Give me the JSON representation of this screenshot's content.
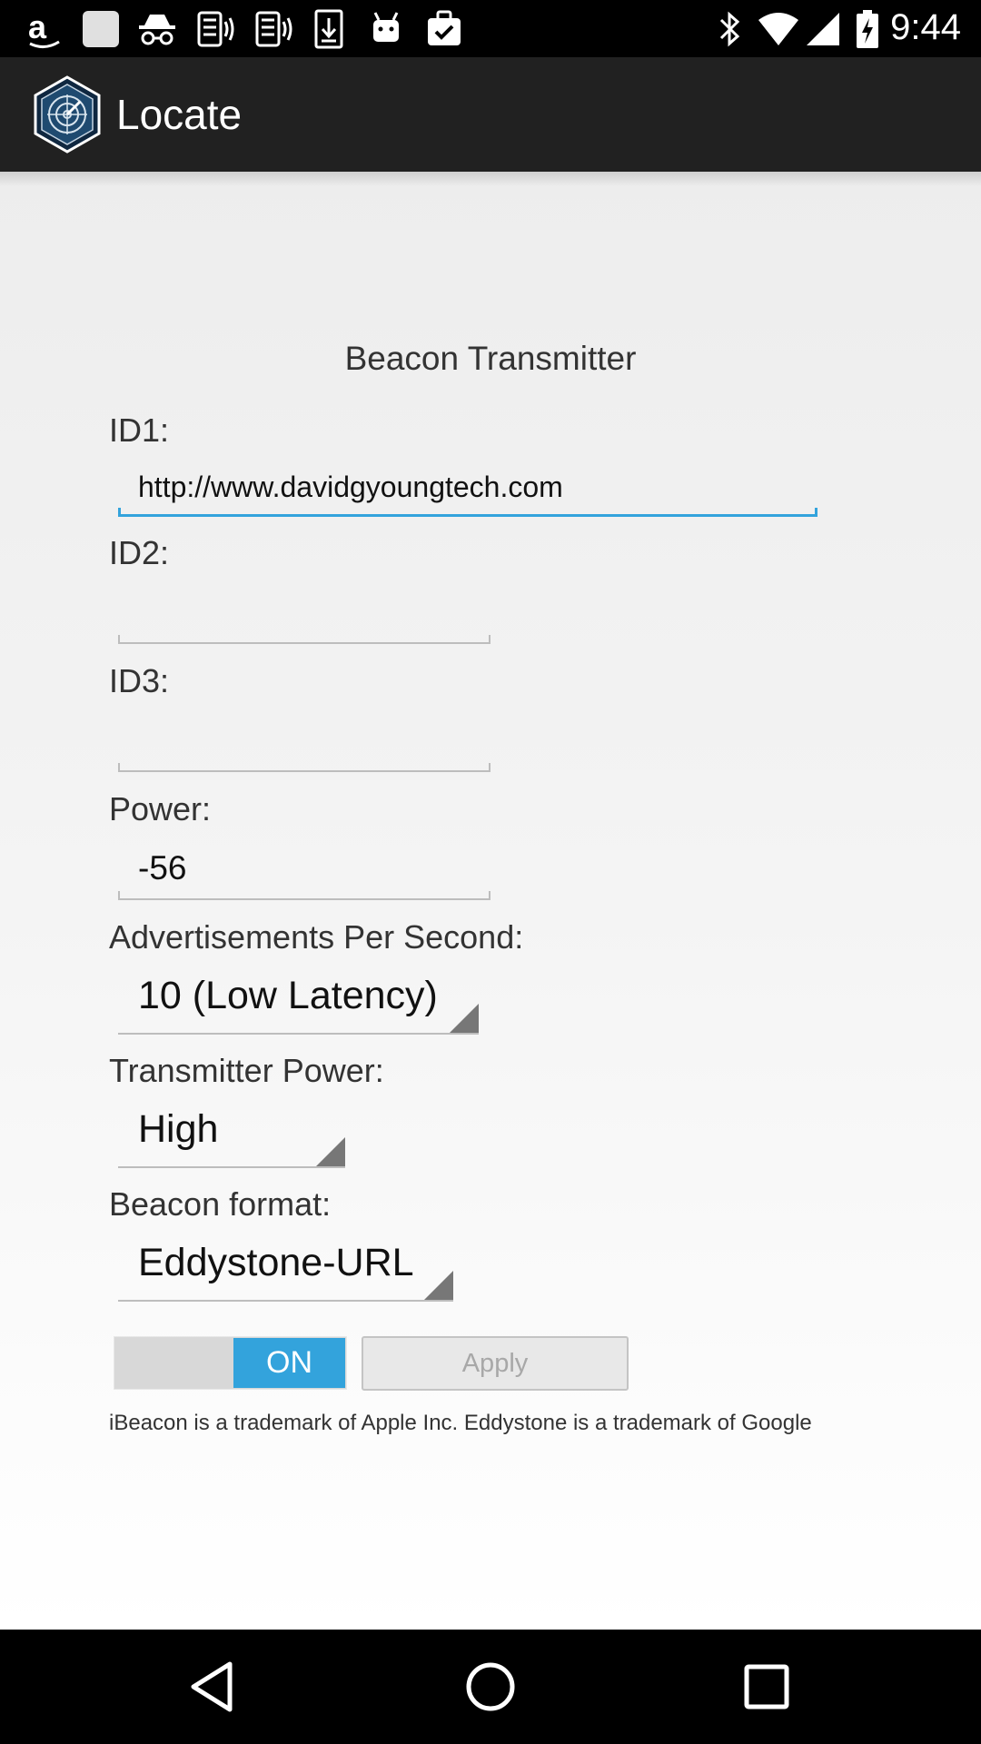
{
  "status_bar": {
    "time": "9:44",
    "left_icons": [
      "amazon-icon",
      "blank-app-icon",
      "incognito-icon",
      "phone-signal-icon",
      "phone-signal-icon-2",
      "download-icon",
      "android-icon",
      "checkbox-briefcase-icon"
    ],
    "right_icons": [
      "bluetooth-icon",
      "wifi-icon",
      "cell-signal-icon",
      "battery-charging-icon"
    ]
  },
  "action_bar": {
    "title": "Locate",
    "logo_icon": "radar-hexagon-icon"
  },
  "form": {
    "screen_title": "Beacon Transmitter",
    "id1_label": "ID1:",
    "id1_value": "http://www.davidgyoungtech.com",
    "id2_label": "ID2:",
    "id2_value": "",
    "id3_label": "ID3:",
    "id3_value": "",
    "power_label": "Power:",
    "power_value": "-56",
    "ads_label": "Advertisements Per Second:",
    "ads_value": "10 (Low Latency)",
    "tx_power_label": "Transmitter Power:",
    "tx_power_value": "High",
    "format_label": "Beacon format:",
    "format_value": "Eddystone-URL",
    "toggle_label": "ON",
    "apply_label": "Apply",
    "trademark_text": "iBeacon is a trademark of Apple Inc.  Eddystone is a trademark of Google"
  },
  "nav_bar": {
    "icons": [
      "back-icon",
      "home-icon",
      "recents-icon"
    ]
  },
  "colors": {
    "accent": "#33a3dc",
    "action_bar": "#212121"
  }
}
